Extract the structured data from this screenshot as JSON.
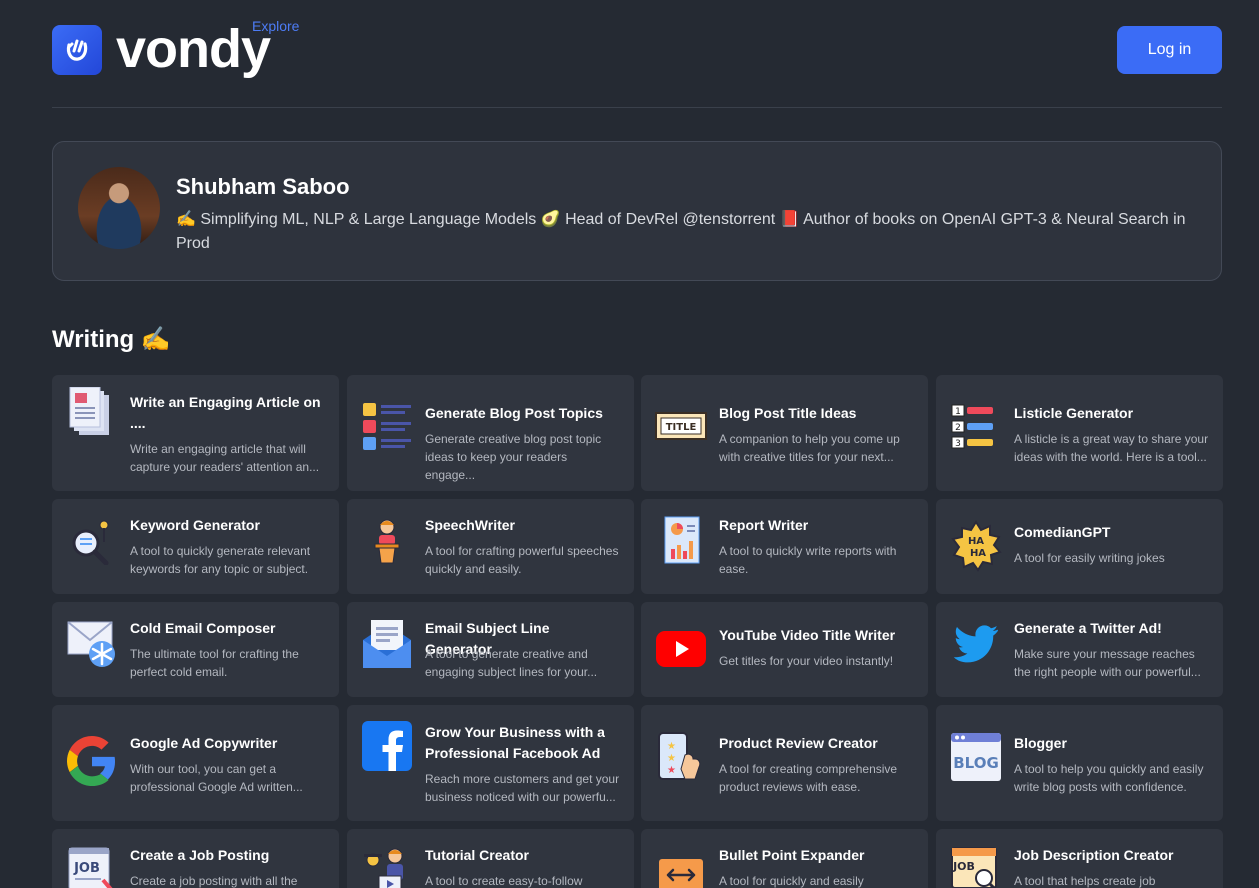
{
  "header": {
    "logo_text": "vondy",
    "explore_label": "Explore",
    "login_label": "Log in"
  },
  "profile": {
    "name": "Shubham Saboo",
    "bio": "✍️ Simplifying ML, NLP & Large Language Models 🥑 Head of DevRel @tenstorrent 📕 Author of books on OpenAI GPT-3 & Neural Search in Prod"
  },
  "section": {
    "title": "Writing ✍️"
  },
  "cards": [
    {
      "title": "Write an Engaging Article on ....",
      "desc": "Write an engaging article that will capture your readers' attention an...",
      "icon": "document-pages-icon"
    },
    {
      "title": "Generate Blog Post Topics",
      "desc": "Generate creative blog post topic ideas to keep your readers engage...",
      "icon": "color-list-icon"
    },
    {
      "title": "Blog Post Title Ideas",
      "desc": "A companion to help you come up with creative titles for your next...",
      "icon": "title-banner-icon"
    },
    {
      "title": "Listicle Generator",
      "desc": "A listicle is a great way to share your ideas with the world. Here is a tool...",
      "icon": "numbered-list-icon"
    },
    {
      "title": "Keyword Generator",
      "desc": "A tool to quickly generate relevant keywords for any topic or subject.",
      "icon": "magnifier-key-icon"
    },
    {
      "title": "SpeechWriter",
      "desc": "A tool for crafting powerful speeches quickly and easily.",
      "icon": "speaker-podium-icon"
    },
    {
      "title": "Report Writer",
      "desc": "A tool to quickly write reports with ease.",
      "icon": "report-chart-icon"
    },
    {
      "title": "ComedianGPT",
      "desc": "A tool for easily writing jokes",
      "icon": "haha-burst-icon"
    },
    {
      "title": "Cold Email Composer",
      "desc": "The ultimate tool for crafting the perfect cold email.",
      "icon": "cold-email-icon"
    },
    {
      "title": "Email Subject Line Generator",
      "desc": "A tool to generate creative and engaging subject lines for your...",
      "icon": "open-envelope-icon"
    },
    {
      "title": "YouTube Video Title Writer",
      "desc": "Get titles for your video instantly!",
      "icon": "youtube-icon"
    },
    {
      "title": "Generate a Twitter Ad!",
      "desc": "Make sure your message reaches the right people with our powerful...",
      "icon": "twitter-bird-icon"
    },
    {
      "title": "Google Ad Copywriter",
      "desc": "With our tool, you can get a professional Google Ad written...",
      "icon": "google-icon"
    },
    {
      "title": "Grow Your Business with a Professional Facebook Ad",
      "desc": "Reach more customers and get your business noticed with our powerfu...",
      "icon": "facebook-icon"
    },
    {
      "title": "Product Review Creator",
      "desc": "A tool for creating comprehensive product reviews with ease.",
      "icon": "phone-review-icon"
    },
    {
      "title": "Blogger",
      "desc": "A tool to help you quickly and easily write blog posts with confidence.",
      "icon": "blog-window-icon"
    },
    {
      "title": "Create a Job Posting",
      "desc": "Create a job posting with all the",
      "icon": "job-board-icon"
    },
    {
      "title": "Tutorial Creator",
      "desc": "A tool to create easy-to-follow",
      "icon": "tutor-presenter-icon"
    },
    {
      "title": "Bullet Point Expander",
      "desc": "A tool for quickly and easily",
      "icon": "expand-arrows-icon"
    },
    {
      "title": "Job Description Creator",
      "desc": "A tool that helps create job",
      "icon": "job-magnifier-icon"
    }
  ]
}
